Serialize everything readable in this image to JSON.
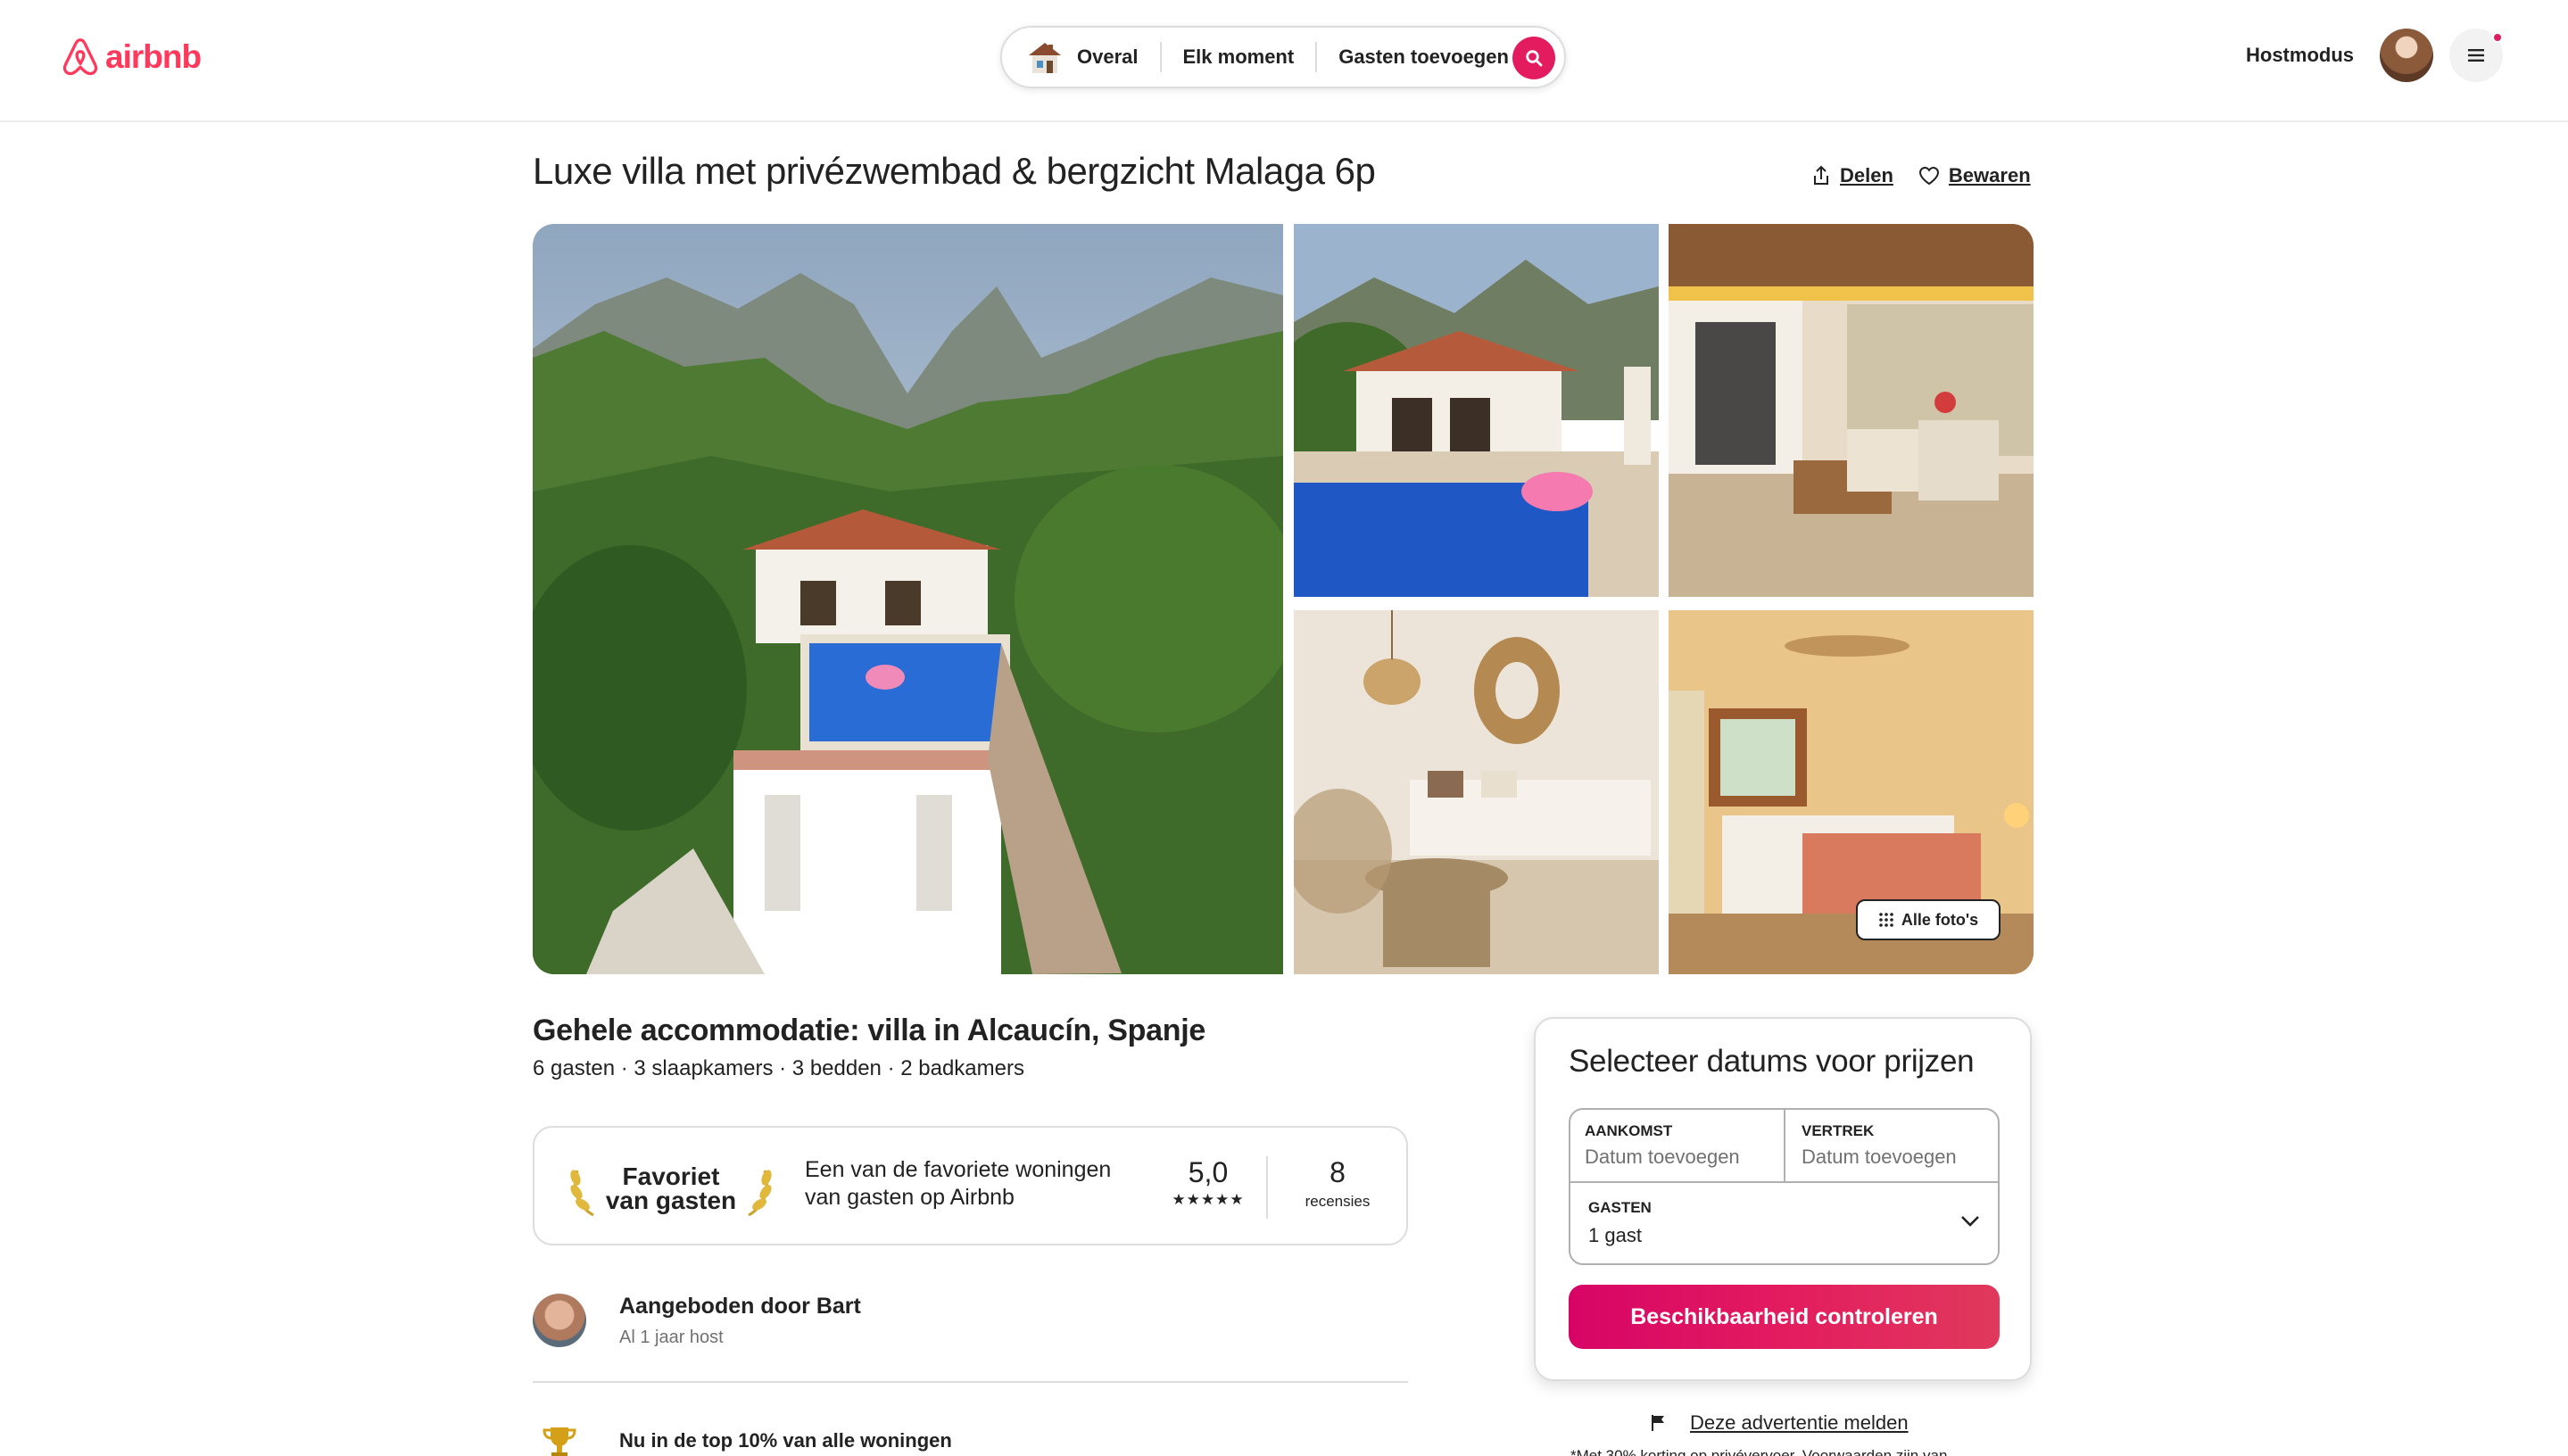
{
  "header": {
    "logo_text": "airbnb",
    "search": {
      "where": "Overal",
      "when": "Elk moment",
      "who": "Gasten toevoegen"
    },
    "hostmode": "Hostmodus"
  },
  "listing": {
    "title": "Luxe villa met privézwembad & bergzicht Malaga 6p",
    "share_label": "Delen",
    "save_label": "Bewaren",
    "all_photos_label": "Alle foto's",
    "subtitle": "Gehele accommodatie: villa in Alcaucín, Spanje",
    "details": "6 gasten · 3 slaapkamers · 3 bedden · 2 badkamers"
  },
  "favorite": {
    "badge_line1": "Favoriet",
    "badge_line2": "van gasten",
    "description": "Een van de favoriete woningen van gasten op Airbnb",
    "rating": "5,0",
    "stars": "★★★★★",
    "reviews_count": "8",
    "reviews_label": "recensies"
  },
  "host": {
    "offered_by": "Aangeboden door Bart",
    "since": "Al 1 jaar host"
  },
  "highlight": {
    "top10": "Nu in de top 10% van alle woningen"
  },
  "booking": {
    "title": "Selecteer datums voor prijzen",
    "checkin_label": "AANKOMST",
    "checkin_value": "Datum toevoegen",
    "checkout_label": "VERTREK",
    "checkout_value": "Datum toevoegen",
    "guests_label": "GASTEN",
    "guests_value": "1 gast",
    "availability_button": "Beschikbaarheid controleren",
    "report_label": "Deze advertentie melden",
    "footnote": "*Met 30% korting op privévervoer. Voorwaarden zijn van..."
  },
  "colors": {
    "brand": "#ff385c",
    "cta": "#e31c5f",
    "text": "#222222",
    "muted": "#717171",
    "border": "#dddddd"
  },
  "icons": {
    "search": "search-icon",
    "menu": "hamburger-menu-icon",
    "share": "share-icon",
    "save": "heart-icon",
    "grid": "grid-icon",
    "chevron": "chevron-down-icon",
    "flag": "flag-icon",
    "trophy": "trophy-icon"
  }
}
